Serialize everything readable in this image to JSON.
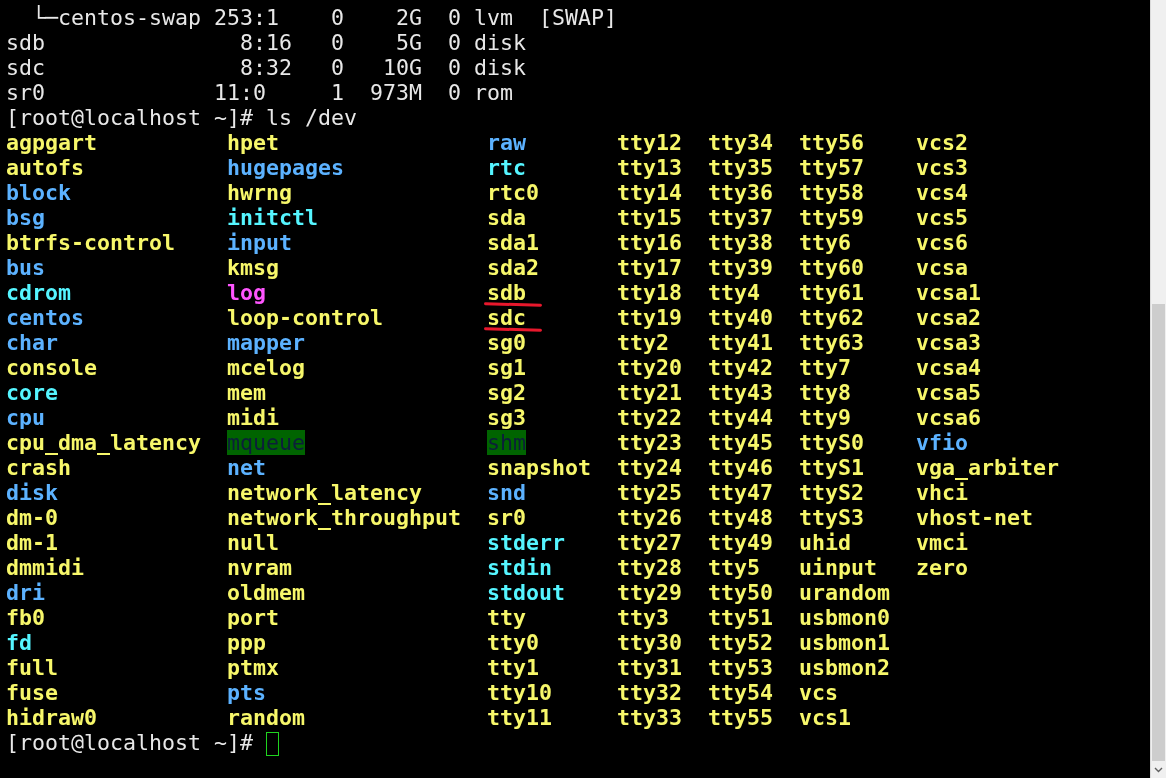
{
  "output_lines": [
    "  └─centos-swap 253:1    0    2G  0 lvm  [SWAP]",
    "sdb               8:16   0    5G  0 disk",
    "sdc               8:32   0   10G  0 disk",
    "sr0             11:0     1  973M  0 rom"
  ],
  "command_line": "[root@localhost ~]# ls /dev",
  "listing": {
    "columns": [
      [
        {
          "name": "agpgart",
          "kind": "dev",
          "underlined": false
        },
        {
          "name": "autofs",
          "kind": "dev",
          "underlined": false
        },
        {
          "name": "block",
          "kind": "dir",
          "underlined": false
        },
        {
          "name": "bsg",
          "kind": "dir",
          "underlined": false
        },
        {
          "name": "btrfs-control",
          "kind": "dev",
          "underlined": false
        },
        {
          "name": "bus",
          "kind": "dir",
          "underlined": false
        },
        {
          "name": "cdrom",
          "kind": "link",
          "underlined": false
        },
        {
          "name": "centos",
          "kind": "dir",
          "underlined": false
        },
        {
          "name": "char",
          "kind": "dir",
          "underlined": false
        },
        {
          "name": "console",
          "kind": "dev",
          "underlined": false
        },
        {
          "name": "core",
          "kind": "link",
          "underlined": false
        },
        {
          "name": "cpu",
          "kind": "dir",
          "underlined": false
        },
        {
          "name": "cpu_dma_latency",
          "kind": "dev",
          "underlined": false
        },
        {
          "name": "crash",
          "kind": "dev",
          "underlined": false
        },
        {
          "name": "disk",
          "kind": "dir",
          "underlined": false
        },
        {
          "name": "dm-0",
          "kind": "dev",
          "underlined": false
        },
        {
          "name": "dm-1",
          "kind": "dev",
          "underlined": false
        },
        {
          "name": "dmmidi",
          "kind": "dev",
          "underlined": false
        },
        {
          "name": "dri",
          "kind": "dir",
          "underlined": false
        },
        {
          "name": "fb0",
          "kind": "dev",
          "underlined": false
        },
        {
          "name": "fd",
          "kind": "link",
          "underlined": false
        },
        {
          "name": "full",
          "kind": "dev",
          "underlined": false
        },
        {
          "name": "fuse",
          "kind": "dev",
          "underlined": false
        },
        {
          "name": "hidraw0",
          "kind": "dev",
          "underlined": false
        }
      ],
      [
        {
          "name": "hpet",
          "kind": "dev",
          "underlined": false
        },
        {
          "name": "hugepages",
          "kind": "dir",
          "underlined": false
        },
        {
          "name": "hwrng",
          "kind": "dev",
          "underlined": false
        },
        {
          "name": "initctl",
          "kind": "link",
          "underlined": false
        },
        {
          "name": "input",
          "kind": "dir",
          "underlined": false
        },
        {
          "name": "kmsg",
          "kind": "dev",
          "underlined": false
        },
        {
          "name": "log",
          "kind": "socket",
          "underlined": false
        },
        {
          "name": "loop-control",
          "kind": "dev",
          "underlined": false
        },
        {
          "name": "mapper",
          "kind": "dir",
          "underlined": false
        },
        {
          "name": "mcelog",
          "kind": "dev",
          "underlined": false
        },
        {
          "name": "mem",
          "kind": "dev",
          "underlined": false
        },
        {
          "name": "midi",
          "kind": "dev",
          "underlined": false
        },
        {
          "name": "mqueue",
          "kind": "sticky",
          "underlined": false
        },
        {
          "name": "net",
          "kind": "dir",
          "underlined": false
        },
        {
          "name": "network_latency",
          "kind": "dev",
          "underlined": false
        },
        {
          "name": "network_throughput",
          "kind": "dev",
          "underlined": false
        },
        {
          "name": "null",
          "kind": "dev",
          "underlined": false
        },
        {
          "name": "nvram",
          "kind": "dev",
          "underlined": false
        },
        {
          "name": "oldmem",
          "kind": "dev",
          "underlined": false
        },
        {
          "name": "port",
          "kind": "dev",
          "underlined": false
        },
        {
          "name": "ppp",
          "kind": "dev",
          "underlined": false
        },
        {
          "name": "ptmx",
          "kind": "dev",
          "underlined": false
        },
        {
          "name": "pts",
          "kind": "dir",
          "underlined": false
        },
        {
          "name": "random",
          "kind": "dev",
          "underlined": false
        }
      ],
      [
        {
          "name": "raw",
          "kind": "dir",
          "underlined": false
        },
        {
          "name": "rtc",
          "kind": "link",
          "underlined": false
        },
        {
          "name": "rtc0",
          "kind": "dev",
          "underlined": false
        },
        {
          "name": "sda",
          "kind": "dev",
          "underlined": false
        },
        {
          "name": "sda1",
          "kind": "dev",
          "underlined": false
        },
        {
          "name": "sda2",
          "kind": "dev",
          "underlined": false
        },
        {
          "name": "sdb",
          "kind": "dev",
          "underlined": true
        },
        {
          "name": "sdc",
          "kind": "dev",
          "underlined": true
        },
        {
          "name": "sg0",
          "kind": "dev",
          "underlined": false
        },
        {
          "name": "sg1",
          "kind": "dev",
          "underlined": false
        },
        {
          "name": "sg2",
          "kind": "dev",
          "underlined": false
        },
        {
          "name": "sg3",
          "kind": "dev",
          "underlined": false
        },
        {
          "name": "shm",
          "kind": "sticky",
          "underlined": false
        },
        {
          "name": "snapshot",
          "kind": "dev",
          "underlined": false
        },
        {
          "name": "snd",
          "kind": "dir",
          "underlined": false
        },
        {
          "name": "sr0",
          "kind": "dev",
          "underlined": false
        },
        {
          "name": "stderr",
          "kind": "link",
          "underlined": false
        },
        {
          "name": "stdin",
          "kind": "link",
          "underlined": false
        },
        {
          "name": "stdout",
          "kind": "link",
          "underlined": false
        },
        {
          "name": "tty",
          "kind": "dev",
          "underlined": false
        },
        {
          "name": "tty0",
          "kind": "dev",
          "underlined": false
        },
        {
          "name": "tty1",
          "kind": "dev",
          "underlined": false
        },
        {
          "name": "tty10",
          "kind": "dev",
          "underlined": false
        },
        {
          "name": "tty11",
          "kind": "dev",
          "underlined": false
        }
      ],
      [
        {
          "name": "tty12",
          "kind": "dev",
          "underlined": false
        },
        {
          "name": "tty13",
          "kind": "dev",
          "underlined": false
        },
        {
          "name": "tty14",
          "kind": "dev",
          "underlined": false
        },
        {
          "name": "tty15",
          "kind": "dev",
          "underlined": false
        },
        {
          "name": "tty16",
          "kind": "dev",
          "underlined": false
        },
        {
          "name": "tty17",
          "kind": "dev",
          "underlined": false
        },
        {
          "name": "tty18",
          "kind": "dev",
          "underlined": false
        },
        {
          "name": "tty19",
          "kind": "dev",
          "underlined": false
        },
        {
          "name": "tty2",
          "kind": "dev",
          "underlined": false
        },
        {
          "name": "tty20",
          "kind": "dev",
          "underlined": false
        },
        {
          "name": "tty21",
          "kind": "dev",
          "underlined": false
        },
        {
          "name": "tty22",
          "kind": "dev",
          "underlined": false
        },
        {
          "name": "tty23",
          "kind": "dev",
          "underlined": false
        },
        {
          "name": "tty24",
          "kind": "dev",
          "underlined": false
        },
        {
          "name": "tty25",
          "kind": "dev",
          "underlined": false
        },
        {
          "name": "tty26",
          "kind": "dev",
          "underlined": false
        },
        {
          "name": "tty27",
          "kind": "dev",
          "underlined": false
        },
        {
          "name": "tty28",
          "kind": "dev",
          "underlined": false
        },
        {
          "name": "tty29",
          "kind": "dev",
          "underlined": false
        },
        {
          "name": "tty3",
          "kind": "dev",
          "underlined": false
        },
        {
          "name": "tty30",
          "kind": "dev",
          "underlined": false
        },
        {
          "name": "tty31",
          "kind": "dev",
          "underlined": false
        },
        {
          "name": "tty32",
          "kind": "dev",
          "underlined": false
        },
        {
          "name": "tty33",
          "kind": "dev",
          "underlined": false
        }
      ],
      [
        {
          "name": "tty34",
          "kind": "dev",
          "underlined": false
        },
        {
          "name": "tty35",
          "kind": "dev",
          "underlined": false
        },
        {
          "name": "tty36",
          "kind": "dev",
          "underlined": false
        },
        {
          "name": "tty37",
          "kind": "dev",
          "underlined": false
        },
        {
          "name": "tty38",
          "kind": "dev",
          "underlined": false
        },
        {
          "name": "tty39",
          "kind": "dev",
          "underlined": false
        },
        {
          "name": "tty4",
          "kind": "dev",
          "underlined": false
        },
        {
          "name": "tty40",
          "kind": "dev",
          "underlined": false
        },
        {
          "name": "tty41",
          "kind": "dev",
          "underlined": false
        },
        {
          "name": "tty42",
          "kind": "dev",
          "underlined": false
        },
        {
          "name": "tty43",
          "kind": "dev",
          "underlined": false
        },
        {
          "name": "tty44",
          "kind": "dev",
          "underlined": false
        },
        {
          "name": "tty45",
          "kind": "dev",
          "underlined": false
        },
        {
          "name": "tty46",
          "kind": "dev",
          "underlined": false
        },
        {
          "name": "tty47",
          "kind": "dev",
          "underlined": false
        },
        {
          "name": "tty48",
          "kind": "dev",
          "underlined": false
        },
        {
          "name": "tty49",
          "kind": "dev",
          "underlined": false
        },
        {
          "name": "tty5",
          "kind": "dev",
          "underlined": false
        },
        {
          "name": "tty50",
          "kind": "dev",
          "underlined": false
        },
        {
          "name": "tty51",
          "kind": "dev",
          "underlined": false
        },
        {
          "name": "tty52",
          "kind": "dev",
          "underlined": false
        },
        {
          "name": "tty53",
          "kind": "dev",
          "underlined": false
        },
        {
          "name": "tty54",
          "kind": "dev",
          "underlined": false
        },
        {
          "name": "tty55",
          "kind": "dev",
          "underlined": false
        }
      ],
      [
        {
          "name": "tty56",
          "kind": "dev",
          "underlined": false
        },
        {
          "name": "tty57",
          "kind": "dev",
          "underlined": false
        },
        {
          "name": "tty58",
          "kind": "dev",
          "underlined": false
        },
        {
          "name": "tty59",
          "kind": "dev",
          "underlined": false
        },
        {
          "name": "tty6",
          "kind": "dev",
          "underlined": false
        },
        {
          "name": "tty60",
          "kind": "dev",
          "underlined": false
        },
        {
          "name": "tty61",
          "kind": "dev",
          "underlined": false
        },
        {
          "name": "tty62",
          "kind": "dev",
          "underlined": false
        },
        {
          "name": "tty63",
          "kind": "dev",
          "underlined": false
        },
        {
          "name": "tty7",
          "kind": "dev",
          "underlined": false
        },
        {
          "name": "tty8",
          "kind": "dev",
          "underlined": false
        },
        {
          "name": "tty9",
          "kind": "dev",
          "underlined": false
        },
        {
          "name": "ttyS0",
          "kind": "dev",
          "underlined": false
        },
        {
          "name": "ttyS1",
          "kind": "dev",
          "underlined": false
        },
        {
          "name": "ttyS2",
          "kind": "dev",
          "underlined": false
        },
        {
          "name": "ttyS3",
          "kind": "dev",
          "underlined": false
        },
        {
          "name": "uhid",
          "kind": "dev",
          "underlined": false
        },
        {
          "name": "uinput",
          "kind": "dev",
          "underlined": false
        },
        {
          "name": "urandom",
          "kind": "dev",
          "underlined": false
        },
        {
          "name": "usbmon0",
          "kind": "dev",
          "underlined": false
        },
        {
          "name": "usbmon1",
          "kind": "dev",
          "underlined": false
        },
        {
          "name": "usbmon2",
          "kind": "dev",
          "underlined": false
        },
        {
          "name": "vcs",
          "kind": "dev",
          "underlined": false
        },
        {
          "name": "vcs1",
          "kind": "dev",
          "underlined": false
        }
      ],
      [
        {
          "name": "vcs2",
          "kind": "dev",
          "underlined": false
        },
        {
          "name": "vcs3",
          "kind": "dev",
          "underlined": false
        },
        {
          "name": "vcs4",
          "kind": "dev",
          "underlined": false
        },
        {
          "name": "vcs5",
          "kind": "dev",
          "underlined": false
        },
        {
          "name": "vcs6",
          "kind": "dev",
          "underlined": false
        },
        {
          "name": "vcsa",
          "kind": "dev",
          "underlined": false
        },
        {
          "name": "vcsa1",
          "kind": "dev",
          "underlined": false
        },
        {
          "name": "vcsa2",
          "kind": "dev",
          "underlined": false
        },
        {
          "name": "vcsa3",
          "kind": "dev",
          "underlined": false
        },
        {
          "name": "vcsa4",
          "kind": "dev",
          "underlined": false
        },
        {
          "name": "vcsa5",
          "kind": "dev",
          "underlined": false
        },
        {
          "name": "vcsa6",
          "kind": "dev",
          "underlined": false
        },
        {
          "name": "vfio",
          "kind": "dir",
          "underlined": false
        },
        {
          "name": "vga_arbiter",
          "kind": "dev",
          "underlined": false
        },
        {
          "name": "vhci",
          "kind": "dev",
          "underlined": false
        },
        {
          "name": "vhost-net",
          "kind": "dev",
          "underlined": false
        },
        {
          "name": "vmci",
          "kind": "dev",
          "underlined": false
        },
        {
          "name": "zero",
          "kind": "dev",
          "underlined": false
        }
      ]
    ]
  },
  "prompt": "[root@localhost ~]#"
}
